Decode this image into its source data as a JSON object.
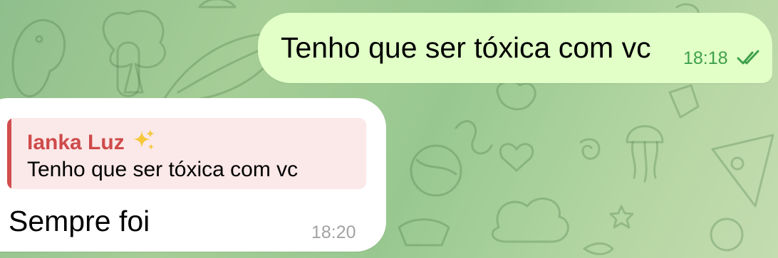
{
  "theme": {
    "outgoing_bubble": "#e1ffc7",
    "incoming_bubble": "#ffffff",
    "accent_green": "#3ea04a",
    "reply_author_color": "#cf4a4a",
    "reply_bg": "#fbe8e8"
  },
  "messages": [
    {
      "direction": "outgoing",
      "text": "Tenho que ser tóxica com vc",
      "time": "18:18",
      "status_icon": "double-check-icon"
    },
    {
      "direction": "incoming",
      "reply_to": {
        "author": "Ianka Luz",
        "author_emoji_icon": "sparkles-icon",
        "text": "Tenho que ser tóxica com vc"
      },
      "text": "Sempre foi",
      "time": "18:20"
    }
  ]
}
